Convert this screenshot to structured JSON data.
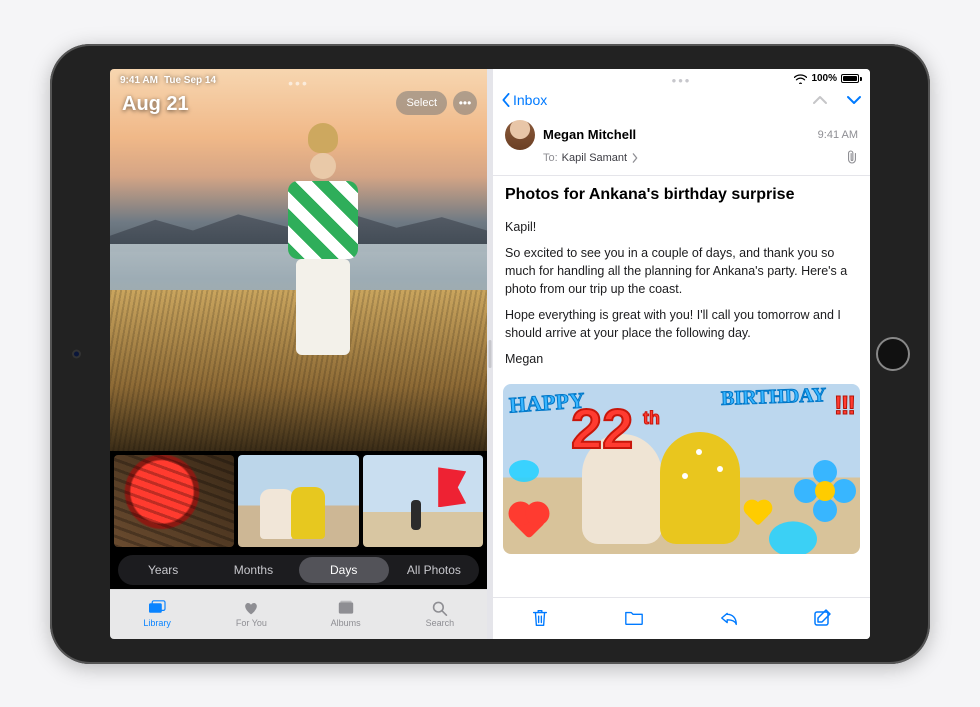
{
  "status": {
    "time": "9:41 AM",
    "date": "Tue Sep 14",
    "wifi_icon": "wifi",
    "battery_pct": "100%"
  },
  "photos": {
    "heading_date": "Aug 21",
    "select_label": "Select",
    "segments": {
      "years": "Years",
      "months": "Months",
      "days": "Days",
      "all": "All Photos",
      "active": "days"
    },
    "tabs": {
      "library": "Library",
      "for_you": "For You",
      "albums": "Albums",
      "search": "Search",
      "active": "library"
    }
  },
  "mail": {
    "back_label": "Inbox",
    "sender": "Megan Mitchell",
    "time": "9:41 AM",
    "to_label": "To:",
    "to_name": "Kapil Samant",
    "subject": "Photos for Ankana's birthday surprise",
    "body": {
      "greeting": "Kapil!",
      "p1": "So excited to see you in a couple of days, and thank you so much for handling all the planning for Ankana's party. Here's a photo from our trip up the coast.",
      "p2": "Hope everything is great with you! I'll call you tomorrow and I should arrive at your place the following day.",
      "signoff": "Megan"
    },
    "attachment_overlay": {
      "happy": "HAPPY",
      "number": "22",
      "th": "th",
      "birthday": "BIRTHDAY",
      "excl": "!!!"
    },
    "toolbar_icons": [
      "trash",
      "folder",
      "reply",
      "compose"
    ]
  }
}
